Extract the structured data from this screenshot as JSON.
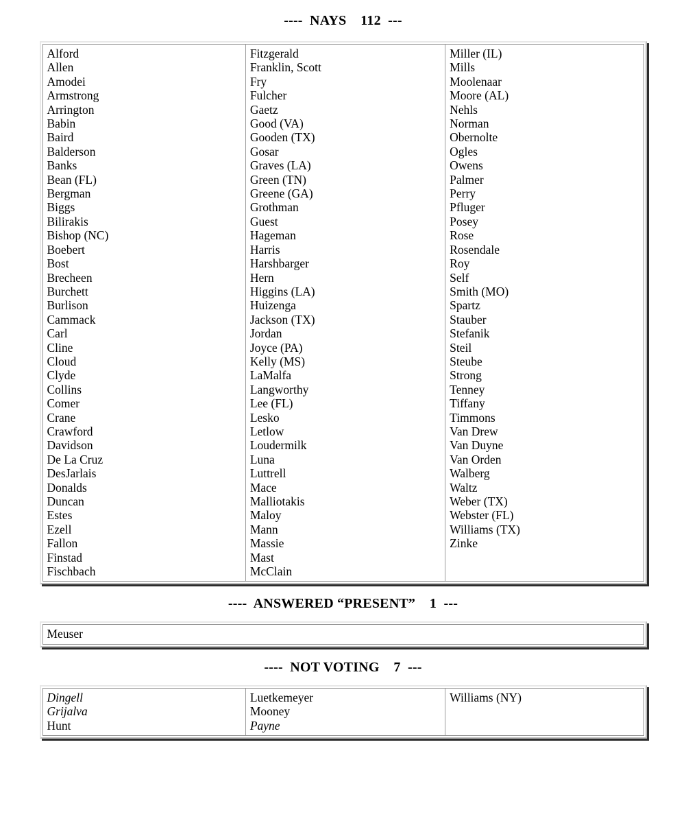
{
  "document": {
    "type": "house-roll-call-vote-tally"
  },
  "sections": [
    {
      "id": "nays",
      "heading": "----  NAYS    112  ---",
      "label": "NAYS",
      "count": "112",
      "columns": [
        {
          "names": [
            {
              "text": "Alford",
              "italic": false
            },
            {
              "text": "Allen",
              "italic": false
            },
            {
              "text": "Amodei",
              "italic": false
            },
            {
              "text": "Armstrong",
              "italic": false
            },
            {
              "text": "Arrington",
              "italic": false
            },
            {
              "text": "Babin",
              "italic": false
            },
            {
              "text": "Baird",
              "italic": false
            },
            {
              "text": "Balderson",
              "italic": false
            },
            {
              "text": "Banks",
              "italic": false
            },
            {
              "text": "Bean (FL)",
              "italic": false
            },
            {
              "text": "Bergman",
              "italic": false
            },
            {
              "text": "Biggs",
              "italic": false
            },
            {
              "text": "Bilirakis",
              "italic": false
            },
            {
              "text": "Bishop (NC)",
              "italic": false
            },
            {
              "text": "Boebert",
              "italic": false
            },
            {
              "text": "Bost",
              "italic": false
            },
            {
              "text": "Brecheen",
              "italic": false
            },
            {
              "text": "Burchett",
              "italic": false
            },
            {
              "text": "Burlison",
              "italic": false
            },
            {
              "text": "Cammack",
              "italic": false
            },
            {
              "text": "Carl",
              "italic": false
            },
            {
              "text": "Cline",
              "italic": false
            },
            {
              "text": "Cloud",
              "italic": false
            },
            {
              "text": "Clyde",
              "italic": false
            },
            {
              "text": "Collins",
              "italic": false
            },
            {
              "text": "Comer",
              "italic": false
            },
            {
              "text": "Crane",
              "italic": false
            },
            {
              "text": "Crawford",
              "italic": false
            },
            {
              "text": "Davidson",
              "italic": false
            },
            {
              "text": "De La Cruz",
              "italic": false
            },
            {
              "text": "DesJarlais",
              "italic": false
            },
            {
              "text": "Donalds",
              "italic": false
            },
            {
              "text": "Duncan",
              "italic": false
            },
            {
              "text": "Estes",
              "italic": false
            },
            {
              "text": "Ezell",
              "italic": false
            },
            {
              "text": "Fallon",
              "italic": false
            },
            {
              "text": "Finstad",
              "italic": false
            },
            {
              "text": "Fischbach",
              "italic": false
            }
          ]
        },
        {
          "names": [
            {
              "text": "Fitzgerald",
              "italic": false
            },
            {
              "text": "Franklin, Scott",
              "italic": false
            },
            {
              "text": "Fry",
              "italic": false
            },
            {
              "text": "Fulcher",
              "italic": false
            },
            {
              "text": "Gaetz",
              "italic": false
            },
            {
              "text": "Good (VA)",
              "italic": false
            },
            {
              "text": "Gooden (TX)",
              "italic": false
            },
            {
              "text": "Gosar",
              "italic": false
            },
            {
              "text": "Graves (LA)",
              "italic": false
            },
            {
              "text": "Green (TN)",
              "italic": false
            },
            {
              "text": "Greene (GA)",
              "italic": false
            },
            {
              "text": "Grothman",
              "italic": false
            },
            {
              "text": "Guest",
              "italic": false
            },
            {
              "text": "Hageman",
              "italic": false
            },
            {
              "text": "Harris",
              "italic": false
            },
            {
              "text": "Harshbarger",
              "italic": false
            },
            {
              "text": "Hern",
              "italic": false
            },
            {
              "text": "Higgins (LA)",
              "italic": false
            },
            {
              "text": "Huizenga",
              "italic": false
            },
            {
              "text": "Jackson (TX)",
              "italic": false
            },
            {
              "text": "Jordan",
              "italic": false
            },
            {
              "text": "Joyce (PA)",
              "italic": false
            },
            {
              "text": "Kelly (MS)",
              "italic": false
            },
            {
              "text": "LaMalfa",
              "italic": false
            },
            {
              "text": "Langworthy",
              "italic": false
            },
            {
              "text": "Lee (FL)",
              "italic": false
            },
            {
              "text": "Lesko",
              "italic": false
            },
            {
              "text": "Letlow",
              "italic": false
            },
            {
              "text": "Loudermilk",
              "italic": false
            },
            {
              "text": "Luna",
              "italic": false
            },
            {
              "text": "Luttrell",
              "italic": false
            },
            {
              "text": "Mace",
              "italic": false
            },
            {
              "text": "Malliotakis",
              "italic": false
            },
            {
              "text": "Maloy",
              "italic": false
            },
            {
              "text": "Mann",
              "italic": false
            },
            {
              "text": "Massie",
              "italic": false
            },
            {
              "text": "Mast",
              "italic": false
            },
            {
              "text": "McClain",
              "italic": false
            }
          ]
        },
        {
          "names": [
            {
              "text": "Miller (IL)",
              "italic": false
            },
            {
              "text": "Mills",
              "italic": false
            },
            {
              "text": "Moolenaar",
              "italic": false
            },
            {
              "text": "Moore (AL)",
              "italic": false
            },
            {
              "text": "Nehls",
              "italic": false
            },
            {
              "text": "Norman",
              "italic": false
            },
            {
              "text": "Obernolte",
              "italic": false
            },
            {
              "text": "Ogles",
              "italic": false
            },
            {
              "text": "Owens",
              "italic": false
            },
            {
              "text": "Palmer",
              "italic": false
            },
            {
              "text": "Perry",
              "italic": false
            },
            {
              "text": "Pfluger",
              "italic": false
            },
            {
              "text": "Posey",
              "italic": false
            },
            {
              "text": "Rose",
              "italic": false
            },
            {
              "text": "Rosendale",
              "italic": false
            },
            {
              "text": "Roy",
              "italic": false
            },
            {
              "text": "Self",
              "italic": false
            },
            {
              "text": "Smith (MO)",
              "italic": false
            },
            {
              "text": "Spartz",
              "italic": false
            },
            {
              "text": "Stauber",
              "italic": false
            },
            {
              "text": "Stefanik",
              "italic": false
            },
            {
              "text": "Steil",
              "italic": false
            },
            {
              "text": "Steube",
              "italic": false
            },
            {
              "text": "Strong",
              "italic": false
            },
            {
              "text": "Tenney",
              "italic": false
            },
            {
              "text": "Tiffany",
              "italic": false
            },
            {
              "text": "Timmons",
              "italic": false
            },
            {
              "text": "Van Drew",
              "italic": false
            },
            {
              "text": "Van Duyne",
              "italic": false
            },
            {
              "text": "Van Orden",
              "italic": false
            },
            {
              "text": "Walberg",
              "italic": false
            },
            {
              "text": "Waltz",
              "italic": false
            },
            {
              "text": "Weber (TX)",
              "italic": false
            },
            {
              "text": "Webster (FL)",
              "italic": false
            },
            {
              "text": "Williams (TX)",
              "italic": false
            },
            {
              "text": "Zinke",
              "italic": false
            }
          ]
        }
      ]
    },
    {
      "id": "present",
      "heading": "----  ANSWERED “PRESENT”    1  ---",
      "label": "ANSWERED “PRESENT”",
      "count": "1",
      "columns": [
        {
          "names": [
            {
              "text": "Meuser",
              "italic": false
            }
          ]
        }
      ]
    },
    {
      "id": "not-voting",
      "heading": "----  NOT VOTING    7  ---",
      "label": "NOT VOTING",
      "count": "7",
      "columns": [
        {
          "names": [
            {
              "text": "Dingell",
              "italic": true
            },
            {
              "text": "Grijalva",
              "italic": true
            },
            {
              "text": "Hunt",
              "italic": false
            }
          ]
        },
        {
          "names": [
            {
              "text": "Luetkemeyer",
              "italic": false
            },
            {
              "text": "Mooney",
              "italic": false
            },
            {
              "text": "Payne",
              "italic": true
            }
          ]
        },
        {
          "names": [
            {
              "text": "Williams (NY)",
              "italic": false
            }
          ]
        }
      ]
    }
  ]
}
